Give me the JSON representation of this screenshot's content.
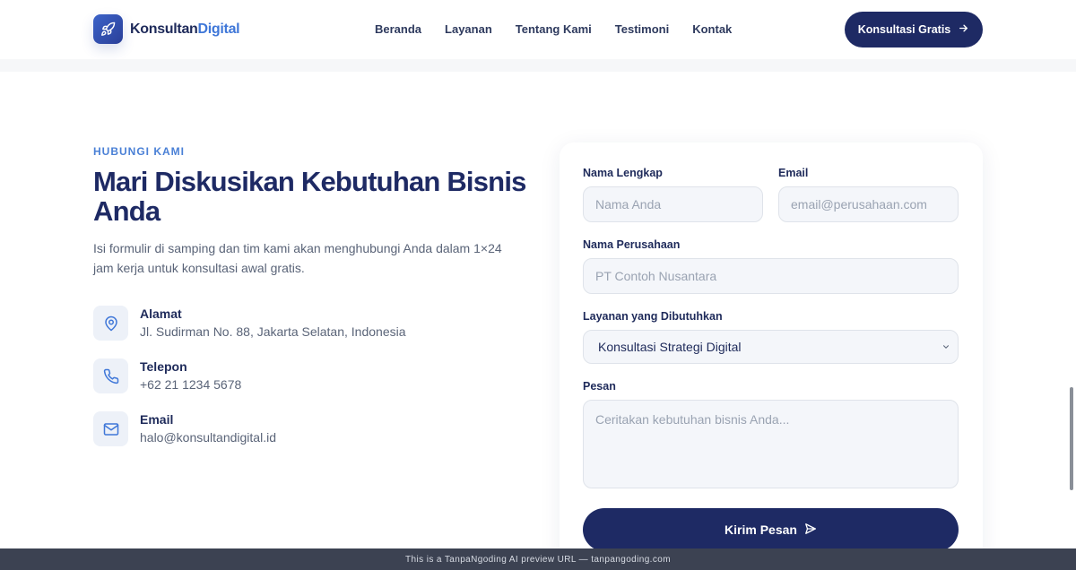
{
  "header": {
    "logo_part1": "Konsultan",
    "logo_part2": "Digital",
    "logo_icon": "rocket-icon",
    "nav": [
      {
        "label": "Beranda"
      },
      {
        "label": "Layanan"
      },
      {
        "label": "Tentang Kami"
      },
      {
        "label": "Testimoni"
      },
      {
        "label": "Kontak"
      }
    ],
    "cta_label": "Konsultasi Gratis",
    "cta_icon": "arrow-right-icon"
  },
  "contact": {
    "eyebrow": "HUBUNGI KAMI",
    "title": "Mari Diskusikan Kebutuhan Bisnis Anda",
    "lead": "Isi formulir di samping dan tim kami akan menghubungi Anda dalam 1×24 jam kerja untuk konsultasi awal gratis.",
    "items": [
      {
        "label": "Alamat",
        "value": "Jl. Sudirman No. 88, Jakarta Selatan, Indonesia",
        "icon": "map-pin-icon"
      },
      {
        "label": "Telepon",
        "value": "+62 21 1234 5678",
        "icon": "phone-icon"
      },
      {
        "label": "Email",
        "value": "halo@konsultandigital.id",
        "icon": "mail-icon"
      }
    ]
  },
  "form": {
    "name_label": "Nama Lengkap",
    "name_placeholder": "Nama Anda",
    "email_label": "Email",
    "email_placeholder": "email@perusahaan.com",
    "company_label": "Nama Perusahaan",
    "company_placeholder": "PT Contoh Nusantara",
    "service_label": "Layanan yang Dibutuhkan",
    "service_selected": "Konsultasi Strategi Digital",
    "message_label": "Pesan",
    "message_placeholder": "Ceritakan kebutuhan bisnis Anda...",
    "submit_label": "Kirim Pesan",
    "submit_icon": "send-icon"
  },
  "preview_bar": {
    "text": "This is a TanpaNgoding AI preview URL — tanpangoding.com"
  },
  "colors": {
    "primary": "#1e2a64",
    "accent": "#3f77d8",
    "muted_text": "#5a6478"
  }
}
